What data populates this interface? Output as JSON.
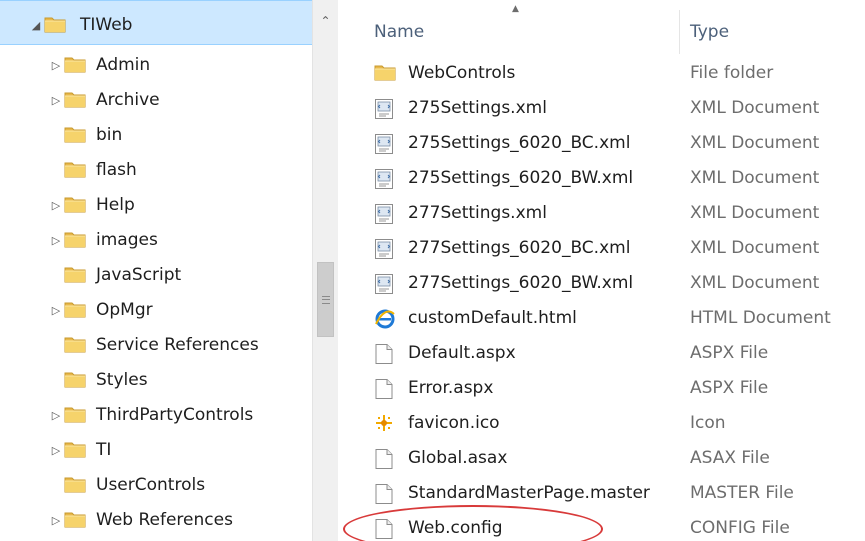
{
  "tree": {
    "items": [
      {
        "label": "TIWeb",
        "expander": "expanded",
        "selected": true
      },
      {
        "label": "Admin",
        "expander": "collapsed"
      },
      {
        "label": "Archive",
        "expander": "collapsed"
      },
      {
        "label": "bin",
        "expander": "none"
      },
      {
        "label": "flash",
        "expander": "none"
      },
      {
        "label": "Help",
        "expander": "collapsed"
      },
      {
        "label": "images",
        "expander": "collapsed"
      },
      {
        "label": "JavaScript",
        "expander": "none"
      },
      {
        "label": "OpMgr",
        "expander": "collapsed"
      },
      {
        "label": "Service References",
        "expander": "none"
      },
      {
        "label": "Styles",
        "expander": "none"
      },
      {
        "label": "ThirdPartyControls",
        "expander": "collapsed"
      },
      {
        "label": "TI",
        "expander": "collapsed"
      },
      {
        "label": "UserControls",
        "expander": "none"
      },
      {
        "label": "Web References",
        "expander": "collapsed"
      }
    ],
    "selection_color": "#cde8ff"
  },
  "filelist": {
    "columns": {
      "name": "Name",
      "type": "Type"
    },
    "files": [
      {
        "name": "WebControls",
        "type": "File folder",
        "icon": "folder-icon"
      },
      {
        "name": "275Settings.xml",
        "type": "XML Document",
        "icon": "xml-file-icon"
      },
      {
        "name": "275Settings_6020_BC.xml",
        "type": "XML Document",
        "icon": "xml-file-icon"
      },
      {
        "name": "275Settings_6020_BW.xml",
        "type": "XML Document",
        "icon": "xml-file-icon"
      },
      {
        "name": "277Settings.xml",
        "type": "XML Document",
        "icon": "xml-file-icon"
      },
      {
        "name": "277Settings_6020_BC.xml",
        "type": "XML Document",
        "icon": "xml-file-icon"
      },
      {
        "name": "277Settings_6020_BW.xml",
        "type": "XML Document",
        "icon": "xml-file-icon"
      },
      {
        "name": "customDefault.html",
        "type": "HTML Document",
        "icon": "internet-explorer-icon"
      },
      {
        "name": "Default.aspx",
        "type": "ASPX File",
        "icon": "blank-file-icon"
      },
      {
        "name": "Error.aspx",
        "type": "ASPX File",
        "icon": "blank-file-icon"
      },
      {
        "name": "favicon.ico",
        "type": "Icon",
        "icon": "favicon-icon"
      },
      {
        "name": "Global.asax",
        "type": "ASAX File",
        "icon": "blank-file-icon"
      },
      {
        "name": "StandardMasterPage.master",
        "type": "MASTER File",
        "icon": "blank-file-icon"
      },
      {
        "name": "Web.config",
        "type": "CONFIG File",
        "icon": "blank-file-icon",
        "circled": true
      }
    ],
    "annotation_color": "#d83a3a"
  }
}
